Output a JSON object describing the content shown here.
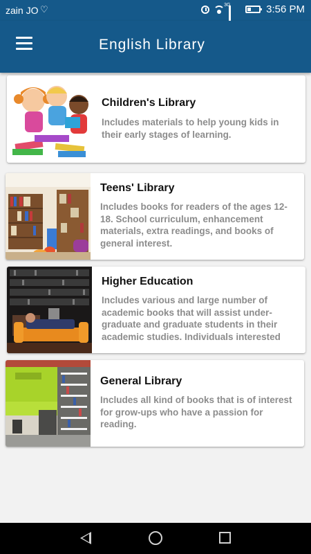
{
  "status_bar": {
    "carrier": "zain JO",
    "network": "3G",
    "time": "3:56 PM",
    "icons": [
      "heart-icon",
      "alarm-icon",
      "wifi-icon",
      "signal-icon",
      "battery-icon"
    ]
  },
  "app_bar": {
    "title": "English Library",
    "menu_icon": "hamburger-menu-icon",
    "color": "#15598a"
  },
  "libraries": [
    {
      "title": "Children's Library",
      "description": "Includes materials to help young kids in their early stages of learning.",
      "image": "children-reading-books-illustration"
    },
    {
      "title": "Teens' Library",
      "description": "Includes books for readers of the ages 12-18. School curriculum, enhancement materials, extra readings, and books of general interest.",
      "image": "library-bookshelves-photo"
    },
    {
      "title": "Higher Education",
      "description": "Includes various and large number of academic books that will assist under-graduate and graduate students in their academic studies. Individuals interested",
      "image": "student-reading-on-sofa-photo"
    },
    {
      "title": "General Library",
      "description": "Includes all kind of books that is of interest for grow-ups who have a passion for reading.",
      "image": "green-library-room-photo"
    }
  ],
  "nav_bar": {
    "icons": [
      "back-icon",
      "home-icon",
      "recent-apps-icon"
    ]
  }
}
